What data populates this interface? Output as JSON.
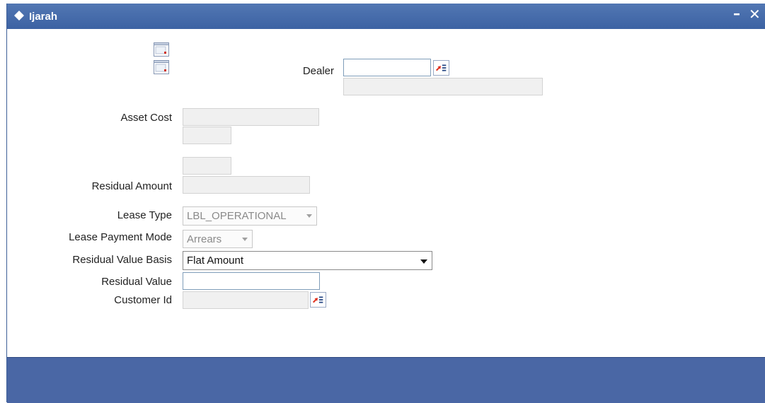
{
  "window": {
    "title": "Ijarah",
    "minimize_glyph": "–",
    "close_glyph": "✕"
  },
  "form": {
    "dealer": {
      "label": "Dealer",
      "value": ""
    },
    "asset_cost": {
      "label": "Asset Cost"
    },
    "residual_amount": {
      "label": "Residual Amount"
    },
    "lease_type": {
      "label": "Lease Type",
      "value": "LBL_OPERATIONAL"
    },
    "lease_payment_mode": {
      "label": "Lease Payment Mode",
      "value": "Arrears"
    },
    "residual_value_basis": {
      "label": "Residual Value Basis",
      "value": "Flat Amount"
    },
    "residual_value": {
      "label": "Residual Value",
      "value": ""
    },
    "customer_id": {
      "label": "Customer Id"
    }
  },
  "icons": {
    "lov": "list-of-values-icon",
    "doc": "document-icon",
    "title": "diamond-icon"
  },
  "colors": {
    "titlebar": "#4a6fae",
    "footer": "#4a67a5",
    "lov_arrow": "#e0301e"
  }
}
